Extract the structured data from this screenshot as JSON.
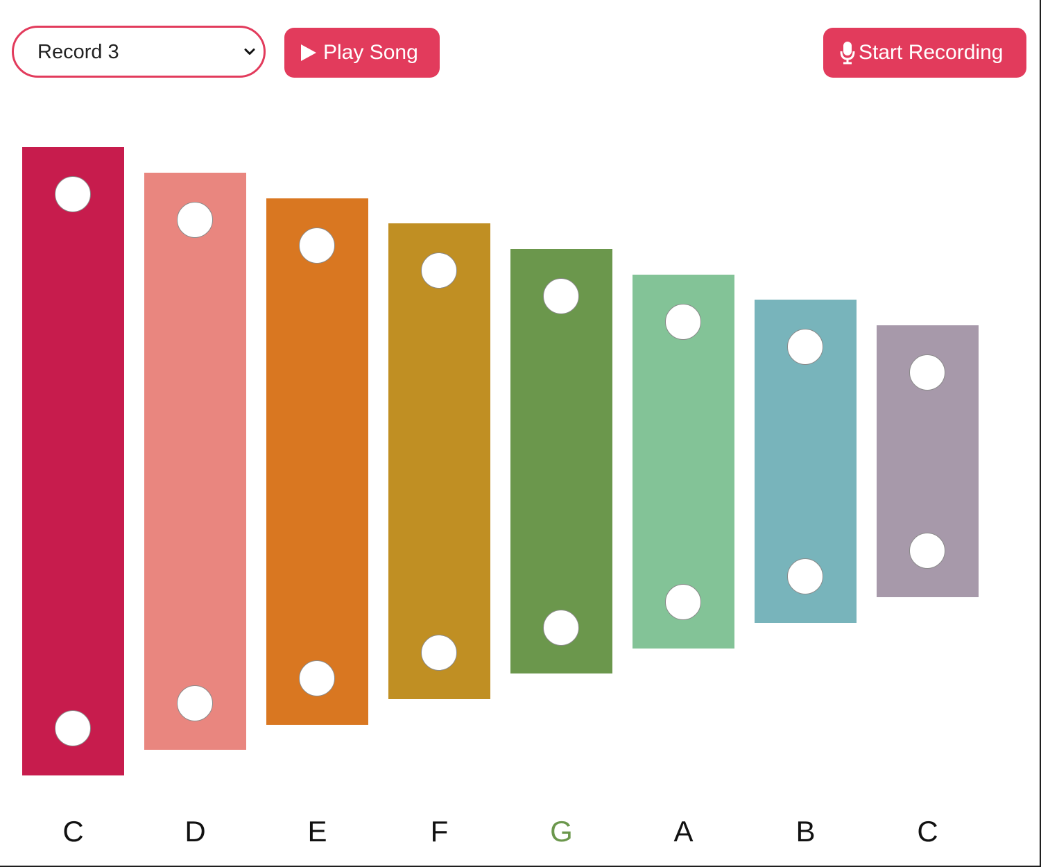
{
  "toolbar": {
    "record_select": {
      "selected": "Record 3",
      "options": [
        "Record 3"
      ]
    },
    "play_button": {
      "label": "Play Song",
      "icon": "play-icon"
    },
    "record_button": {
      "label": "Start Recording",
      "icon": "microphone-icon"
    },
    "accent_color": "#e23b5c"
  },
  "xylophone": {
    "bars": [
      {
        "note": "C",
        "color": "#c71c4d"
      },
      {
        "note": "D",
        "color": "#e9867f"
      },
      {
        "note": "E",
        "color": "#d97721"
      },
      {
        "note": "F",
        "color": "#c08f23"
      },
      {
        "note": "G",
        "color": "#6b974c",
        "label_color": "#6b974c"
      },
      {
        "note": "A",
        "color": "#83c397"
      },
      {
        "note": "B",
        "color": "#78b4bb"
      },
      {
        "note": "C",
        "color": "#a799aa"
      }
    ]
  }
}
